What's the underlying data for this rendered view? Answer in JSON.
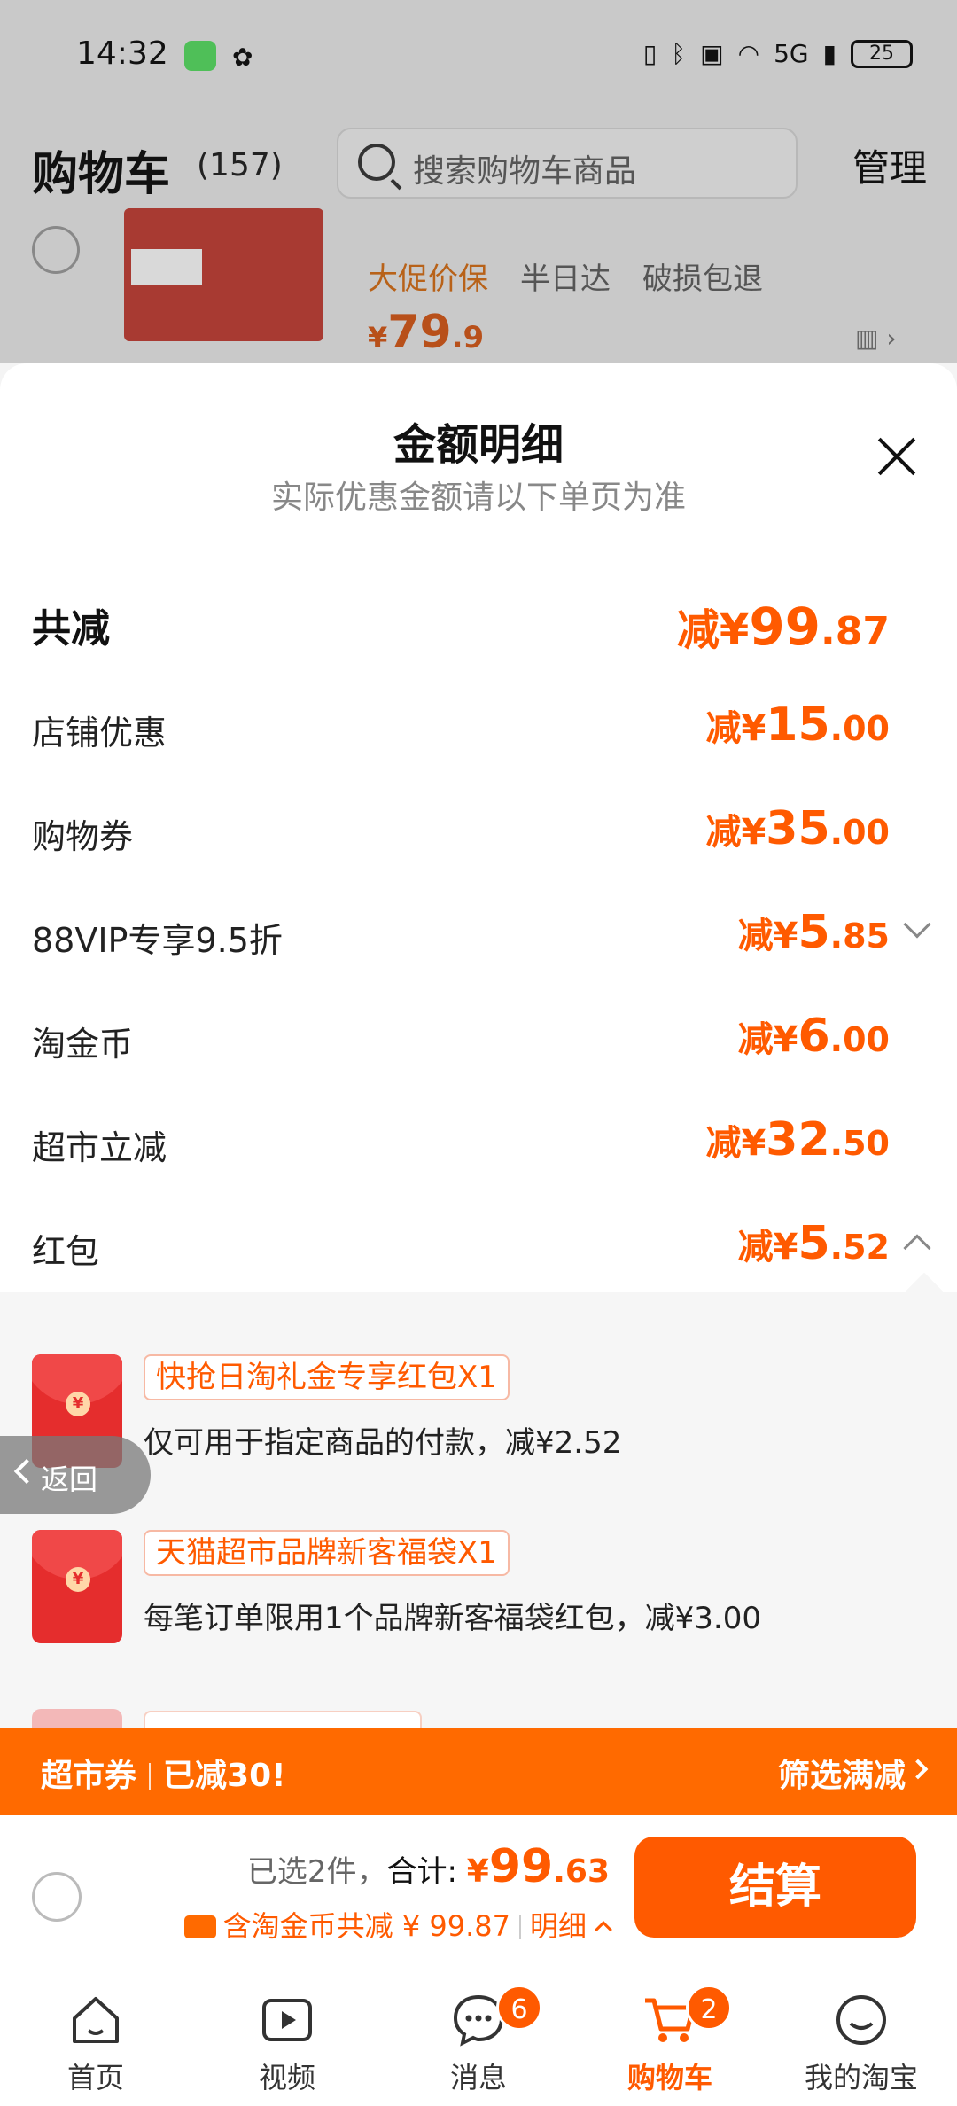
{
  "status_bar": {
    "time": "14:32",
    "network": "5G",
    "battery": "25"
  },
  "header": {
    "title": "购物车",
    "count": "(157)",
    "search_placeholder": "搜索购物车商品",
    "manage_label": "管理"
  },
  "product": {
    "tags": [
      "大促价保",
      "半日达",
      "破损包退"
    ],
    "price_symbol": "¥",
    "price_int": "79",
    "price_dec": ".9"
  },
  "sheet": {
    "title": "金额明细",
    "subtitle": "实际优惠金额请以下单页为准",
    "total": {
      "label": "共减",
      "prefix": "减¥",
      "int": "99",
      "dec": ".87"
    },
    "rows": [
      {
        "label": "店铺优惠",
        "prefix": "减¥",
        "int": "15",
        "dec": ".00"
      },
      {
        "label": "购物券",
        "prefix": "减¥",
        "int": "35",
        "dec": ".00"
      },
      {
        "label": "88VIP专享9.5折",
        "prefix": "减¥",
        "int": "5",
        "dec": ".85"
      },
      {
        "label": "淘金币",
        "prefix": "减¥",
        "int": "6",
        "dec": ".00"
      },
      {
        "label": "超市立减",
        "prefix": "减¥",
        "int": "32",
        "dec": ".50"
      },
      {
        "label": "红包",
        "prefix": "减¥",
        "int": "5",
        "dec": ".52"
      }
    ],
    "red_packets": [
      {
        "coin": "¥",
        "tag": "快抢日淘礼金专享红包X1",
        "desc": "仅可用于指定商品的付款，减¥2.52"
      },
      {
        "coin": "¥",
        "tag": "天猫超市品牌新客福袋X1",
        "desc": "每笔订单限用1个品牌新客福袋红包，减¥3.00"
      }
    ]
  },
  "back_button": "返回",
  "promo_bar": {
    "label": "超市券",
    "status": "已减30!",
    "action": "筛选满减"
  },
  "checkout": {
    "selected": "已选2件，",
    "total_label": "合计: ",
    "price_symbol": "¥",
    "price_int": "99",
    "price_dec": ".63",
    "discount_text": "含淘金币共减 ¥ 99.87",
    "detail_link": "明细",
    "button": "结算"
  },
  "tabs": [
    {
      "label": "首页",
      "icon": "home-icon"
    },
    {
      "label": "视频",
      "icon": "video-icon"
    },
    {
      "label": "消息",
      "icon": "message-icon",
      "badge": "6"
    },
    {
      "label": "购物车",
      "icon": "cart-icon",
      "badge": "2",
      "active": true
    },
    {
      "label": "我的淘宝",
      "icon": "profile-icon"
    }
  ],
  "colors": {
    "accent": "#ff5a00",
    "promo_bg": "#ff6a00"
  }
}
